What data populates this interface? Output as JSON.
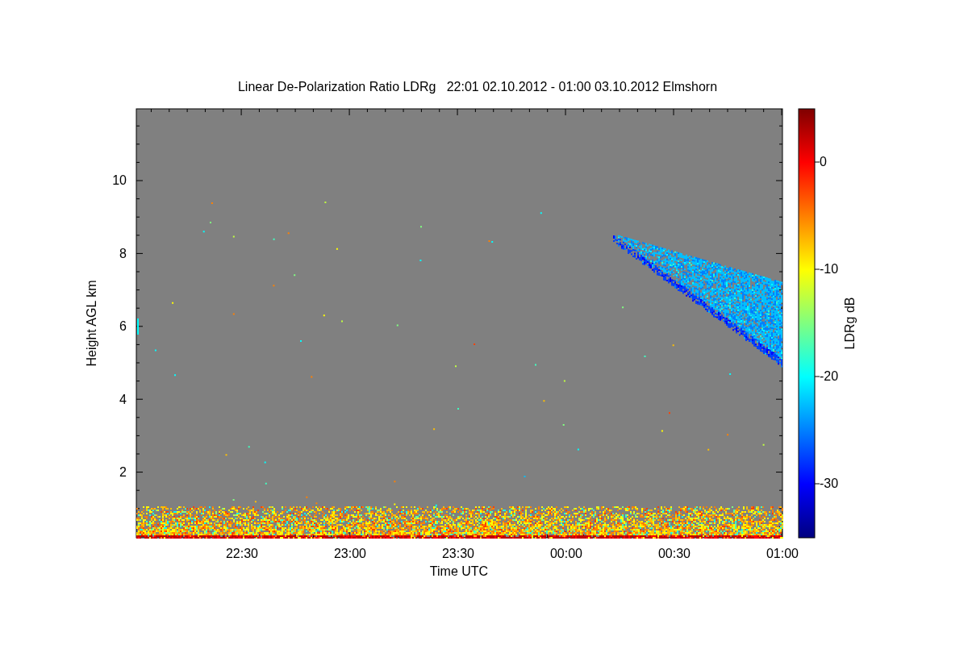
{
  "title": "Linear De-Polarization Ratio LDRg   22:01 02.10.2012 - 01:00 03.10.2012 Elmshorn",
  "y_axis": {
    "label": "Height AGL km",
    "ticks": [
      "10",
      "8",
      "6",
      "4",
      "2"
    ]
  },
  "x_axis": {
    "label": "Time UTC",
    "ticks": [
      "22:30",
      "23:00",
      "23:30",
      "00:00",
      "00:30",
      "01:00"
    ]
  },
  "colorbar": {
    "label": "LDRg dB",
    "ticks": [
      "0",
      "-10",
      "-20",
      "-30"
    ]
  }
}
